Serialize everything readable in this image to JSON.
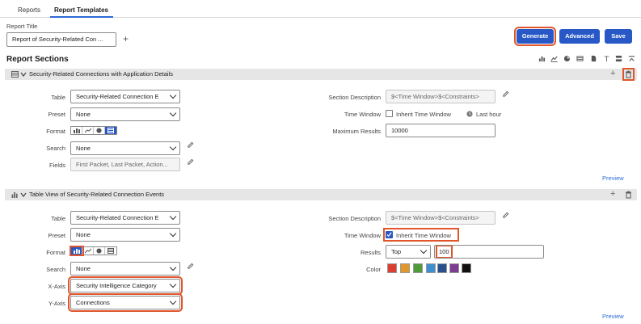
{
  "tabs": [
    {
      "label": "Reports",
      "active": false
    },
    {
      "label": "Report Templates",
      "active": true
    }
  ],
  "report_title": {
    "label": "Report Title",
    "value": "Report of Security-Related Con ..."
  },
  "buttons": {
    "generate": "Generate",
    "advanced": "Advanced",
    "save": "Save"
  },
  "report_sections_heading": "Report Sections",
  "toolbar_icons": [
    "bar-chart-icon",
    "line-chart-icon",
    "pie-chart-icon",
    "table-icon",
    "document-icon",
    "text-icon",
    "page-break-icon",
    "collapse-icon"
  ],
  "section1": {
    "title": "Security-Related Connections with Application Details",
    "table": {
      "label": "Table",
      "value": "Security-Related Connection E"
    },
    "preset": {
      "label": "Preset",
      "value": "None"
    },
    "format": {
      "label": "Format",
      "selected": "table"
    },
    "search": {
      "label": "Search",
      "value": "None"
    },
    "fields": {
      "label": "Fields",
      "value": "First Packet, Last Packet, Action..."
    },
    "section_description": {
      "label": "Section Description",
      "value": "$<Time Window>$<Constraints>"
    },
    "time_window": {
      "label": "Time Window",
      "inherit_label": "Inherit Time Window",
      "inherit_checked": false,
      "last_hour": "Last hour"
    },
    "maximum_results": {
      "label": "Maximum Results",
      "value": "10000"
    },
    "preview": "Preview"
  },
  "section2": {
    "title": "Table View of Security-Related Connection Events",
    "table": {
      "label": "Table",
      "value": "Security-Related Connection E"
    },
    "preset": {
      "label": "Preset",
      "value": "None"
    },
    "format": {
      "label": "Format",
      "selected": "bar"
    },
    "search": {
      "label": "Search",
      "value": "None"
    },
    "x_axis": {
      "label": "X-Axis",
      "value": "Security Intelligence Category"
    },
    "y_axis": {
      "label": "Y-Axis",
      "value": "Connections"
    },
    "section_description": {
      "label": "Section Description",
      "value": "$<Time Window>$<Constraints>"
    },
    "time_window": {
      "label": "Time Window",
      "inherit_label": "Inherit Time Window",
      "inherit_checked": true
    },
    "results": {
      "label": "Results",
      "order": "Top",
      "count": "100"
    },
    "color": {
      "label": "Color",
      "swatches": [
        "#d9402f",
        "#e0982b",
        "#4f9a3a",
        "#3d8fd1",
        "#2a4f8a",
        "#7a3d8f",
        "#111111"
      ]
    },
    "preview": "Preview"
  }
}
